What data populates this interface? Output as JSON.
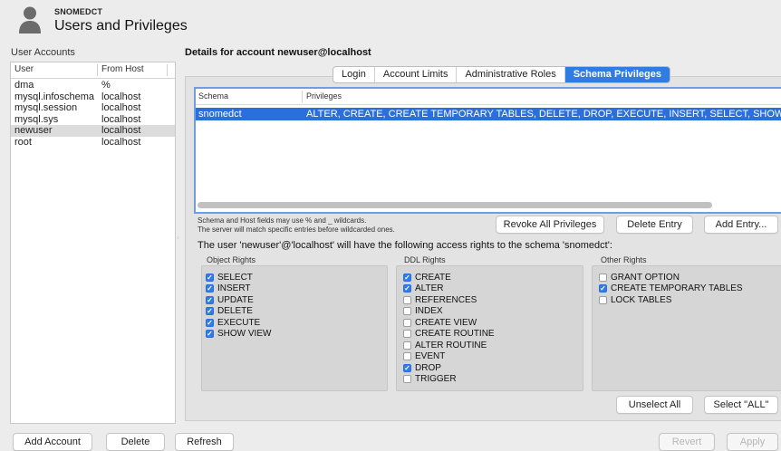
{
  "header": {
    "connection_name": "SNOMEDCT",
    "title": "Users and Privileges"
  },
  "user_accounts": {
    "label": "User Accounts",
    "columns": {
      "user": "User",
      "host": "From Host"
    },
    "rows": [
      {
        "user": "dma",
        "host": "%"
      },
      {
        "user": "mysql.infoschema",
        "host": "localhost"
      },
      {
        "user": "mysql.session",
        "host": "localhost"
      },
      {
        "user": "mysql.sys",
        "host": "localhost"
      },
      {
        "user": "newuser",
        "host": "localhost",
        "selected": true
      },
      {
        "user": "root",
        "host": "localhost"
      }
    ]
  },
  "details": {
    "title": "Details for account newuser@localhost",
    "tabs": [
      {
        "label": "Login"
      },
      {
        "label": "Account Limits"
      },
      {
        "label": "Administrative Roles"
      },
      {
        "label": "Schema Privileges",
        "active": true
      }
    ],
    "schema_table": {
      "columns": {
        "schema": "Schema",
        "privileges": "Privileges"
      },
      "rows": [
        {
          "schema": "snomedct",
          "privileges": "ALTER, CREATE, CREATE TEMPORARY TABLES, DELETE, DROP, EXECUTE, INSERT, SELECT, SHOW VIEW, UPDATE"
        }
      ]
    },
    "hint_line1": "Schema and Host fields may use % and _ wildcards.",
    "hint_line2": "The server will match specific entries before wildcarded ones.",
    "buttons": {
      "revoke_all": "Revoke All Privileges",
      "delete_entry": "Delete Entry",
      "add_entry": "Add Entry...",
      "unselect_all": "Unselect All",
      "select_all": "Select \"ALL\""
    },
    "access_text": "The user 'newuser'@'localhost' will have the following access rights to the schema 'snomedct':",
    "object_rights": {
      "label": "Object Rights",
      "items": [
        {
          "label": "SELECT",
          "checked": true
        },
        {
          "label": "INSERT",
          "checked": true
        },
        {
          "label": "UPDATE",
          "checked": true
        },
        {
          "label": "DELETE",
          "checked": true
        },
        {
          "label": "EXECUTE",
          "checked": true
        },
        {
          "label": "SHOW VIEW",
          "checked": true
        }
      ]
    },
    "ddl_rights": {
      "label": "DDL Rights",
      "items": [
        {
          "label": "CREATE",
          "checked": true
        },
        {
          "label": "ALTER",
          "checked": true
        },
        {
          "label": "REFERENCES",
          "checked": false
        },
        {
          "label": "INDEX",
          "checked": false
        },
        {
          "label": "CREATE VIEW",
          "checked": false
        },
        {
          "label": "CREATE ROUTINE",
          "checked": false
        },
        {
          "label": "ALTER ROUTINE",
          "checked": false
        },
        {
          "label": "EVENT",
          "checked": false
        },
        {
          "label": "DROP",
          "checked": true
        },
        {
          "label": "TRIGGER",
          "checked": false
        }
      ]
    },
    "other_rights": {
      "label": "Other Rights",
      "items": [
        {
          "label": "GRANT OPTION",
          "checked": false
        },
        {
          "label": "CREATE TEMPORARY TABLES",
          "checked": true
        },
        {
          "label": "LOCK TABLES",
          "checked": false
        }
      ]
    }
  },
  "footer": {
    "add_account": "Add Account",
    "delete": "Delete",
    "refresh": "Refresh",
    "revert": "Revert",
    "apply": "Apply"
  },
  "colors": {
    "accent": "#2f7ce3",
    "selection": "#2a6fdb",
    "focus_ring": "#6a9fe6"
  }
}
